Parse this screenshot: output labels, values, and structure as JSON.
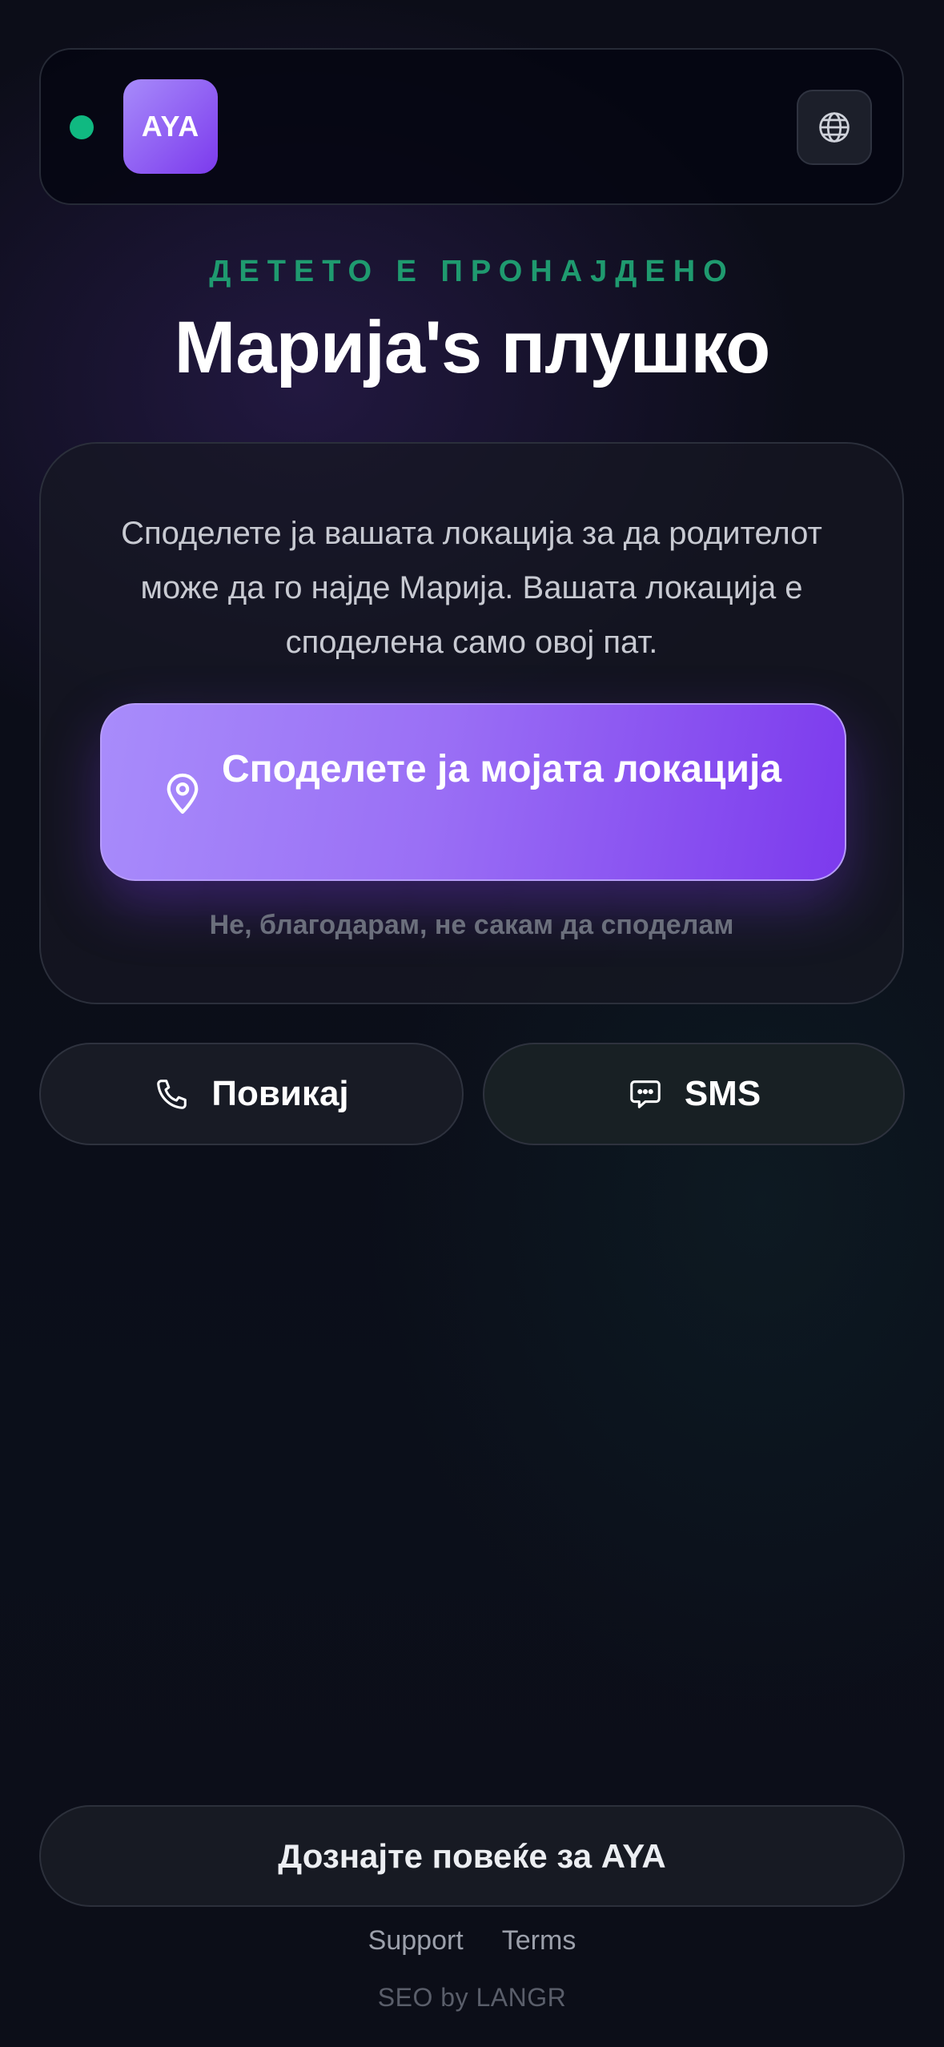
{
  "header": {
    "logo_text": "AYA",
    "status_color": "#10b981",
    "language_icon": "globe-icon"
  },
  "eyebrow": "ДЕТЕТО Е ПРОНАЈДЕНО",
  "title": "Марија's плушко",
  "card": {
    "description": "Споделете ја вашата локација за да родителот може да го најде Марија. Вашата локација е споделена само овој пат.",
    "share_button": {
      "label": "Споделете ја мојата локација",
      "icon": "map-pin-icon"
    },
    "decline_label": "Не, благодарам, не сакам да споделам"
  },
  "actions": {
    "call": {
      "label": "Повикај",
      "icon": "phone-icon"
    },
    "sms": {
      "label": "SMS",
      "icon": "message-icon"
    }
  },
  "footer": {
    "learn_more": "Дознајте повеќе за AYA",
    "links": [
      "Support",
      "Terms"
    ],
    "credit": "SEO by LANGR"
  },
  "colors": {
    "accent": "#7c3aed",
    "accent_light": "#a78bfa",
    "success": "#10b981"
  }
}
